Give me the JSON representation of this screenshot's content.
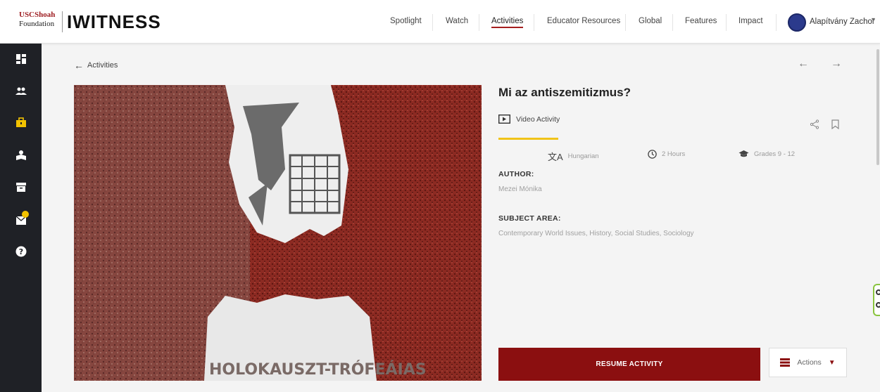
{
  "header": {
    "logo_line1": "USCShoah",
    "logo_line2": "Foundation",
    "brand": "IWITNESS",
    "nav": [
      "Spotlight",
      "Watch",
      "Activities",
      "Educator Resources",
      "Global",
      "Features",
      "Impact"
    ],
    "active_nav": "Activities",
    "user_name": "Alapítvány Zachor"
  },
  "sidebar": {
    "icons": [
      "dashboard-icon",
      "users-icon",
      "activities-icon",
      "student-icon",
      "archive-icon",
      "messages-icon",
      "help-icon"
    ],
    "active": "activities-icon"
  },
  "breadcrumb": {
    "back_label": "Activities"
  },
  "activity": {
    "title": "Mi az antiszemitizmus?",
    "type": "Video Activity",
    "language": "Hungarian",
    "duration": "2 Hours",
    "grades": "Grades 9 - 12",
    "author_label": "AUTHOR:",
    "author": "Mezei Mónika",
    "subject_label": "SUBJECT AREA:",
    "subjects": "Contemporary World Issues, History, Social Studies, Sociology",
    "image_caption_text": "HOLOKAUSZT-TRÓFEÁIAS"
  },
  "actions": {
    "resume_label": "RESUME ACTIVITY",
    "actions_label": "Actions"
  },
  "colors": {
    "accent": "#8b0f10",
    "underline": "#f0c419",
    "sidebar": "#1f2126"
  }
}
